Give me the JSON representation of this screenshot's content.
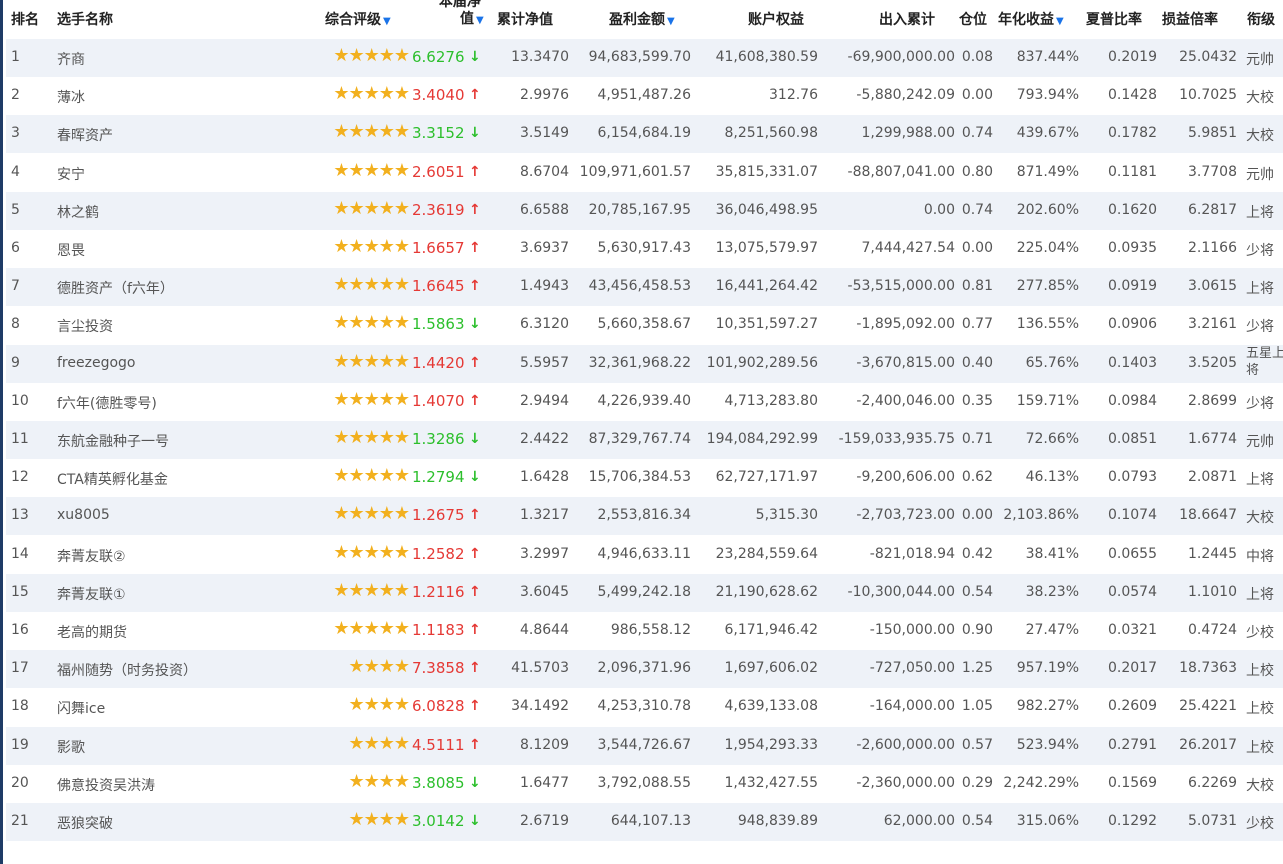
{
  "headers": {
    "rank": "排名",
    "name": "选手名称",
    "rating": "综合评级",
    "nav_top": "本届净",
    "nav_bottom": "值",
    "cum_nav": "累计净值",
    "profit": "盈利金额",
    "equity": "账户权益",
    "inout": "出入累计",
    "position": "仓位",
    "annual": "年化收益",
    "sharpe": "夏普比率",
    "pl_ratio": "损益倍率",
    "title": "衔级"
  },
  "colors": {
    "up": "#e53935",
    "down": "#2cbf2c",
    "star": "#f2b01e",
    "sort": "#1a73e8"
  },
  "rows": [
    {
      "rank": "1",
      "name": "齐商",
      "stars": "★★★★★",
      "nav": "6.6276",
      "dir": "down",
      "cum": "13.3470",
      "profit": "94,683,599.70",
      "equity": "41,608,380.59",
      "inout": "-69,900,000.00",
      "pos": "0.08",
      "annual": "837.44%",
      "sharpe": "0.2019",
      "pl": "25.0432",
      "title": "元帅"
    },
    {
      "rank": "2",
      "name": "薄冰",
      "stars": "★★★★★",
      "nav": "3.4040",
      "dir": "up",
      "cum": "2.9976",
      "profit": "4,951,487.26",
      "equity": "312.76",
      "inout": "-5,880,242.09",
      "pos": "0.00",
      "annual": "793.94%",
      "sharpe": "0.1428",
      "pl": "10.7025",
      "title": "大校"
    },
    {
      "rank": "3",
      "name": "春晖资产",
      "stars": "★★★★★",
      "nav": "3.3152",
      "dir": "down",
      "cum": "3.5149",
      "profit": "6,154,684.19",
      "equity": "8,251,560.98",
      "inout": "1,299,988.00",
      "pos": "0.74",
      "annual": "439.67%",
      "sharpe": "0.1782",
      "pl": "5.9851",
      "title": "大校"
    },
    {
      "rank": "4",
      "name": "安宁",
      "stars": "★★★★★",
      "nav": "2.6051",
      "dir": "up",
      "cum": "8.6704",
      "profit": "109,971,601.57",
      "equity": "35,815,331.07",
      "inout": "-88,807,041.00",
      "pos": "0.80",
      "annual": "871.49%",
      "sharpe": "0.1181",
      "pl": "3.7708",
      "title": "元帅"
    },
    {
      "rank": "5",
      "name": "林之鹤",
      "stars": "★★★★★",
      "nav": "2.3619",
      "dir": "up",
      "cum": "6.6588",
      "profit": "20,785,167.95",
      "equity": "36,046,498.95",
      "inout": "0.00",
      "pos": "0.74",
      "annual": "202.60%",
      "sharpe": "0.1620",
      "pl": "6.2817",
      "title": "上将"
    },
    {
      "rank": "6",
      "name": "恩畏",
      "stars": "★★★★★",
      "nav": "1.6657",
      "dir": "up",
      "cum": "3.6937",
      "profit": "5,630,917.43",
      "equity": "13,075,579.97",
      "inout": "7,444,427.54",
      "pos": "0.00",
      "annual": "225.04%",
      "sharpe": "0.0935",
      "pl": "2.1166",
      "title": "少将"
    },
    {
      "rank": "7",
      "name": "德胜资产（f六年）",
      "stars": "★★★★★",
      "nav": "1.6645",
      "dir": "up",
      "cum": "1.4943",
      "profit": "43,456,458.53",
      "equity": "16,441,264.42",
      "inout": "-53,515,000.00",
      "pos": "0.81",
      "annual": "277.85%",
      "sharpe": "0.0919",
      "pl": "3.0615",
      "title": "上将"
    },
    {
      "rank": "8",
      "name": "言尘投资",
      "stars": "★★★★★",
      "nav": "1.5863",
      "dir": "down",
      "cum": "6.3120",
      "profit": "5,660,358.67",
      "equity": "10,351,597.27",
      "inout": "-1,895,092.00",
      "pos": "0.77",
      "annual": "136.55%",
      "sharpe": "0.0906",
      "pl": "3.2161",
      "title": "少将"
    },
    {
      "rank": "9",
      "name": "freezegogo",
      "stars": "★★★★★",
      "nav": "1.4420",
      "dir": "up",
      "cum": "5.5957",
      "profit": "32,361,968.22",
      "equity": "101,902,289.56",
      "inout": "-3,670,815.00",
      "pos": "0.40",
      "annual": "65.76%",
      "sharpe": "0.1403",
      "pl": "3.5205",
      "title": "五星上将"
    },
    {
      "rank": "10",
      "name": "f六年(德胜零号)",
      "stars": "★★★★★",
      "nav": "1.4070",
      "dir": "up",
      "cum": "2.9494",
      "profit": "4,226,939.40",
      "equity": "4,713,283.80",
      "inout": "-2,400,046.00",
      "pos": "0.35",
      "annual": "159.71%",
      "sharpe": "0.0984",
      "pl": "2.8699",
      "title": "少将"
    },
    {
      "rank": "11",
      "name": "东航金融种子一号",
      "stars": "★★★★★",
      "nav": "1.3286",
      "dir": "down",
      "cum": "2.4422",
      "profit": "87,329,767.74",
      "equity": "194,084,292.99",
      "inout": "-159,033,935.75",
      "pos": "0.71",
      "annual": "72.66%",
      "sharpe": "0.0851",
      "pl": "1.6774",
      "title": "元帅"
    },
    {
      "rank": "12",
      "name": "CTA精英孵化基金",
      "stars": "★★★★★",
      "nav": "1.2794",
      "dir": "down",
      "cum": "1.6428",
      "profit": "15,706,384.53",
      "equity": "62,727,171.97",
      "inout": "-9,200,606.00",
      "pos": "0.62",
      "annual": "46.13%",
      "sharpe": "0.0793",
      "pl": "2.0871",
      "title": "上将"
    },
    {
      "rank": "13",
      "name": "xu8005",
      "stars": "★★★★★",
      "nav": "1.2675",
      "dir": "up",
      "cum": "1.3217",
      "profit": "2,553,816.34",
      "equity": "5,315.30",
      "inout": "-2,703,723.00",
      "pos": "0.00",
      "annual": "2,103.86%",
      "sharpe": "0.1074",
      "pl": "18.6647",
      "title": "大校"
    },
    {
      "rank": "14",
      "name": "奔菁友联②",
      "stars": "★★★★★",
      "nav": "1.2582",
      "dir": "up",
      "cum": "3.2997",
      "profit": "4,946,633.11",
      "equity": "23,284,559.64",
      "inout": "-821,018.94",
      "pos": "0.42",
      "annual": "38.41%",
      "sharpe": "0.0655",
      "pl": "1.2445",
      "title": "中将"
    },
    {
      "rank": "15",
      "name": "奔菁友联①",
      "stars": "★★★★★",
      "nav": "1.2116",
      "dir": "up",
      "cum": "3.6045",
      "profit": "5,499,242.18",
      "equity": "21,190,628.62",
      "inout": "-10,300,044.00",
      "pos": "0.54",
      "annual": "38.23%",
      "sharpe": "0.0574",
      "pl": "1.1010",
      "title": "上将"
    },
    {
      "rank": "16",
      "name": "老高的期货",
      "stars": "★★★★★",
      "nav": "1.1183",
      "dir": "up",
      "cum": "4.8644",
      "profit": "986,558.12",
      "equity": "6,171,946.42",
      "inout": "-150,000.00",
      "pos": "0.90",
      "annual": "27.47%",
      "sharpe": "0.0321",
      "pl": "0.4724",
      "title": "少校"
    },
    {
      "rank": "17",
      "name": "福州随势（时务投资）",
      "stars": "★★★★",
      "nav": "7.3858",
      "dir": "up",
      "cum": "41.5703",
      "profit": "2,096,371.96",
      "equity": "1,697,606.02",
      "inout": "-727,050.00",
      "pos": "1.25",
      "annual": "957.19%",
      "sharpe": "0.2017",
      "pl": "18.7363",
      "title": "上校"
    },
    {
      "rank": "18",
      "name": "闪舞ice",
      "stars": "★★★★",
      "nav": "6.0828",
      "dir": "up",
      "cum": "34.1492",
      "profit": "4,253,310.78",
      "equity": "4,639,133.08",
      "inout": "-164,000.00",
      "pos": "1.05",
      "annual": "982.27%",
      "sharpe": "0.2609",
      "pl": "25.4221",
      "title": "上校"
    },
    {
      "rank": "19",
      "name": "影歌",
      "stars": "★★★★",
      "nav": "4.5111",
      "dir": "up",
      "cum": "8.1209",
      "profit": "3,544,726.67",
      "equity": "1,954,293.33",
      "inout": "-2,600,000.00",
      "pos": "0.57",
      "annual": "523.94%",
      "sharpe": "0.2791",
      "pl": "26.2017",
      "title": "上校"
    },
    {
      "rank": "20",
      "name": "佛意投资吴洪涛",
      "stars": "★★★★",
      "nav": "3.8085",
      "dir": "down",
      "cum": "1.6477",
      "profit": "3,792,088.55",
      "equity": "1,432,427.55",
      "inout": "-2,360,000.00",
      "pos": "0.29",
      "annual": "2,242.29%",
      "sharpe": "0.1569",
      "pl": "6.2269",
      "title": "大校"
    },
    {
      "rank": "21",
      "name": "恶狼突破",
      "stars": "★★★★",
      "nav": "3.0142",
      "dir": "down",
      "cum": "2.6719",
      "profit": "644,107.13",
      "equity": "948,839.89",
      "inout": "62,000.00",
      "pos": "0.54",
      "annual": "315.06%",
      "sharpe": "0.1292",
      "pl": "5.0731",
      "title": "少校"
    }
  ]
}
